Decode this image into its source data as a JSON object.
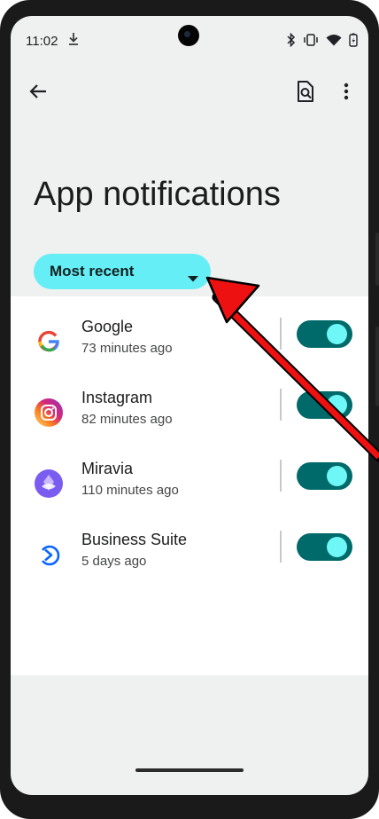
{
  "status_bar": {
    "time": "11:02",
    "icons": [
      "download-icon",
      "bluetooth-icon",
      "vibrate-icon",
      "wifi-icon",
      "battery-icon"
    ]
  },
  "top_bar": {
    "back_icon": "arrow-back-icon",
    "search_icon": "search-in-page-icon",
    "more_icon": "more-vert-icon"
  },
  "page": {
    "title": "App notifications"
  },
  "sort": {
    "selected": "Most recent"
  },
  "apps": [
    {
      "name": "Google",
      "time": "73 minutes ago",
      "icon": "google-icon",
      "enabled": true
    },
    {
      "name": "Instagram",
      "time": "82 minutes ago",
      "icon": "instagram-icon",
      "enabled": true
    },
    {
      "name": "Miravia",
      "time": "110 minutes ago",
      "icon": "miravia-icon",
      "enabled": true
    },
    {
      "name": "Business Suite",
      "time": "5 days ago",
      "icon": "business-suite-icon",
      "enabled": true
    }
  ],
  "colors": {
    "background": "#eff1f0",
    "chip": "#66eef6",
    "toggle_track": "#006a6a",
    "toggle_knob": "#6ff6f6",
    "annotation_arrow": "#ee1111"
  }
}
